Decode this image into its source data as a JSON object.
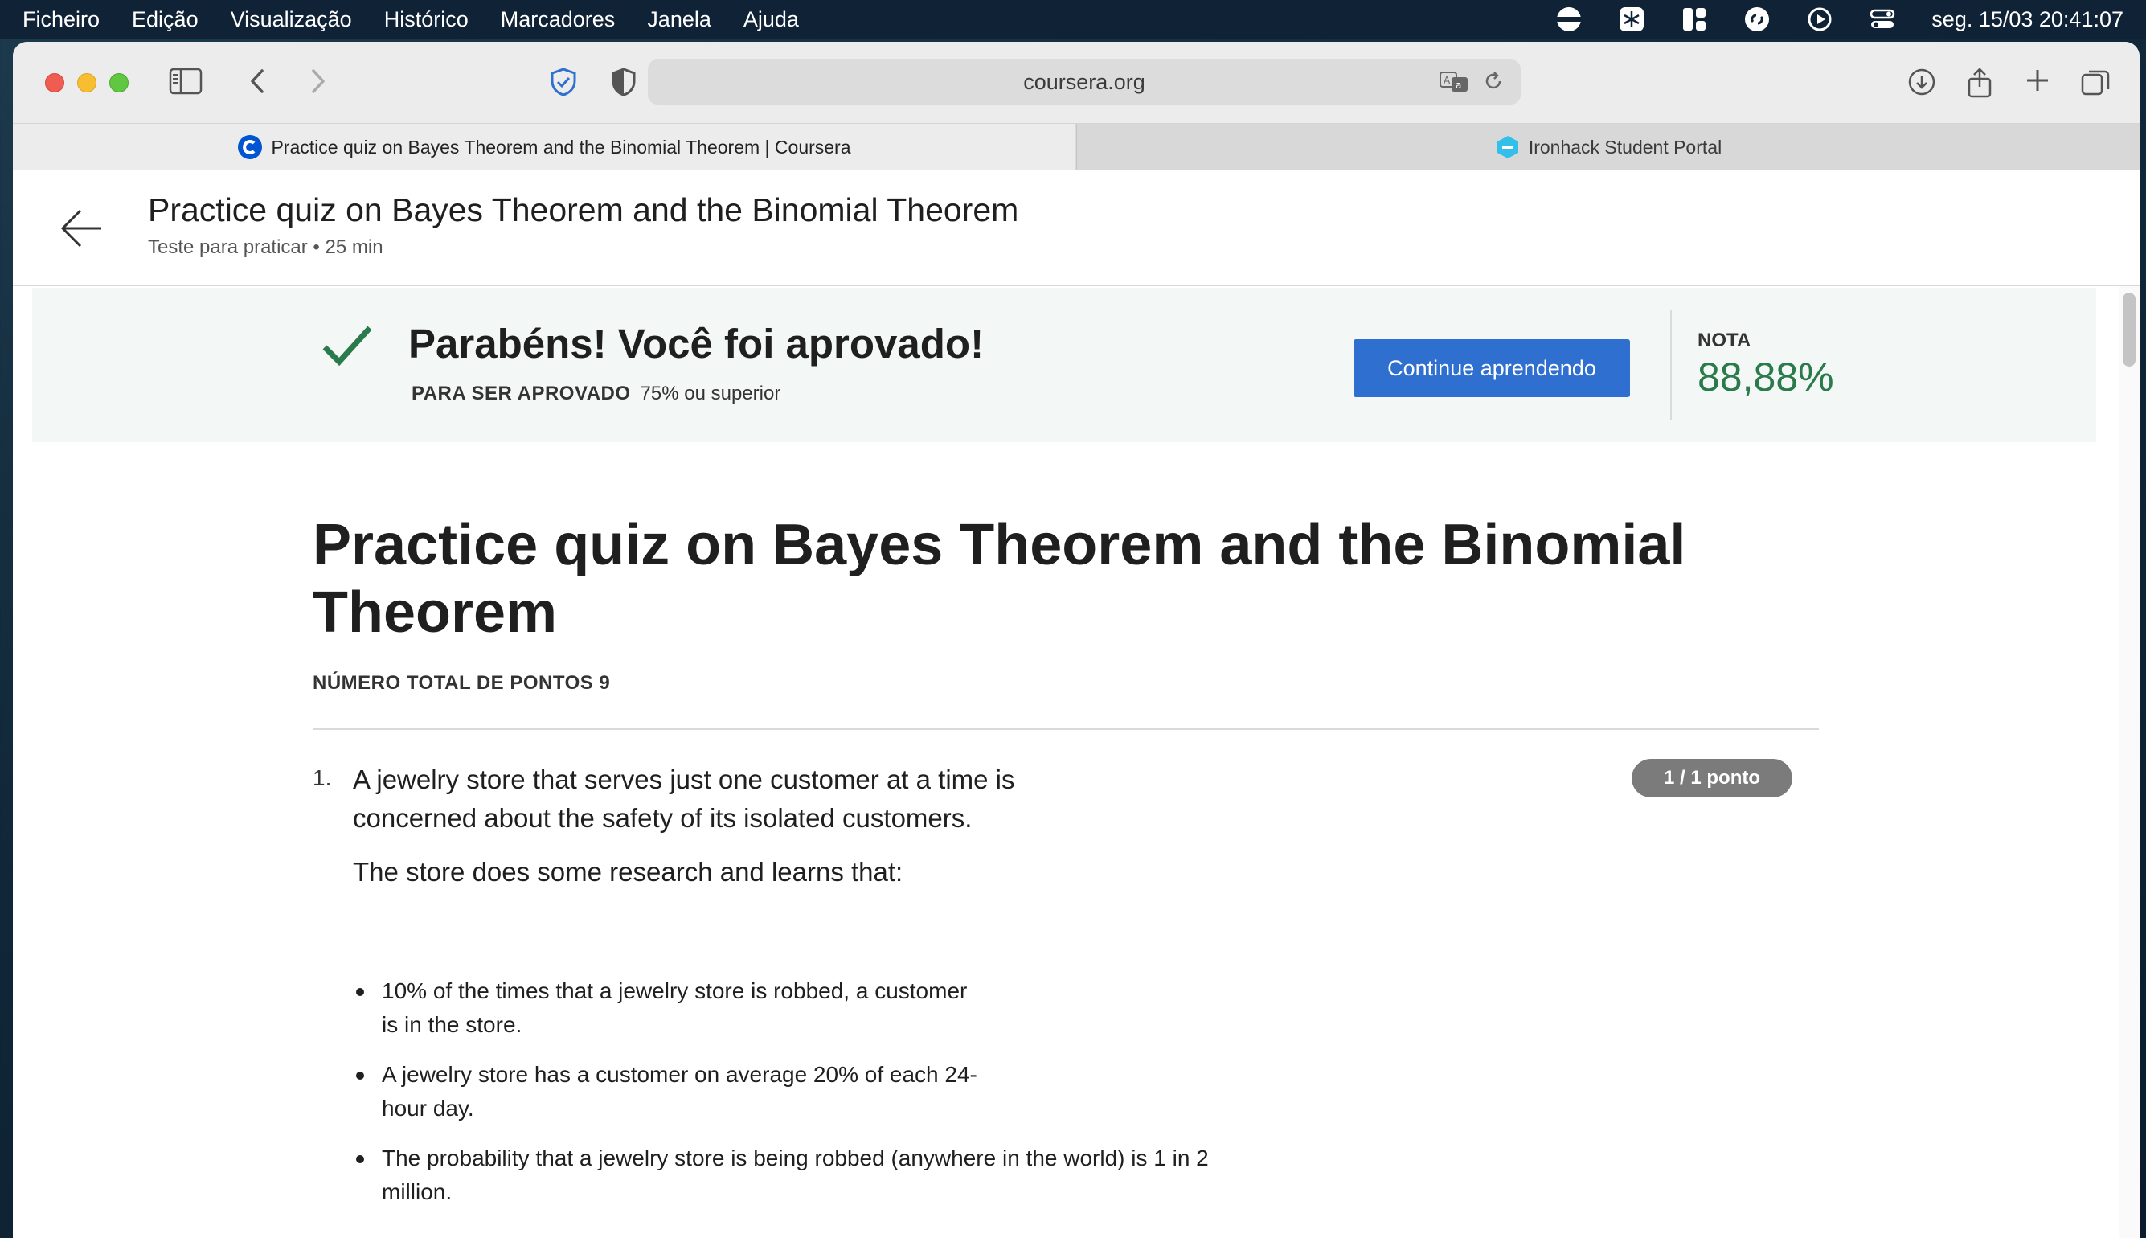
{
  "menubar": {
    "items": [
      "Ficheiro",
      "Edição",
      "Visualização",
      "Histórico",
      "Marcadores",
      "Janela",
      "Ajuda"
    ],
    "clock": "seg. 15/03  20:41:07"
  },
  "browser": {
    "address": "coursera.org",
    "tabs": [
      {
        "label": "Practice quiz on Bayes Theorem and the Binomial Theorem | Coursera",
        "favicon": "coursera-icon"
      },
      {
        "label": "Ironhack Student Portal",
        "favicon": "ironhack-icon"
      }
    ]
  },
  "header": {
    "title": "Practice quiz on Bayes Theorem and the Binomial Theorem",
    "subtitle": "Teste para praticar • 25 min"
  },
  "banner": {
    "title": "Parabéns! Você foi aprovado!",
    "pass_label": "PARA SER APROVADO",
    "pass_value": "75% ou superior",
    "button": "Continue aprendendo",
    "grade_label": "NOTA",
    "grade_value": "88,88%"
  },
  "quiz": {
    "title": "Practice quiz on Bayes Theorem and the Binomial Theorem",
    "total_points": "NÚMERO TOTAL DE PONTOS 9",
    "questions": [
      {
        "number": "1.",
        "text": "A jewelry store that serves just one customer at a time is concerned about the safety of its isolated customers.",
        "points": "1 / 1 ponto",
        "intro": "The store does some research and learns that:",
        "bullets": [
          "10% of the times that a jewelry store is robbed, a customer is in the store.",
          "A jewelry store has a customer on average 20% of each 24-hour day.",
          "The probability that a jewelry store is being robbed (anywhere in the world) is 1 in 2 million."
        ]
      }
    ]
  },
  "colors": {
    "primary_button": "#2f6fd0",
    "grade_green": "#2a7a4b",
    "banner_bg": "#f3f8f6"
  }
}
